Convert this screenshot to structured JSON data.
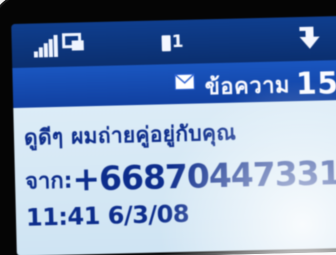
{
  "status_bar": {
    "signal_label": "",
    "sim_slot": "1",
    "colors": {
      "bar": "#0b2f6f",
      "icons": "#f4f7ff"
    },
    "icons": [
      "signal-strength-icon",
      "network-icon",
      "sim-card-icon",
      "arrow-icon"
    ]
  },
  "header": {
    "envelope_icon": "envelope-icon",
    "title": "ข้อความ",
    "message_index": "15",
    "colors": {
      "bar": "#1140a0",
      "text": "#fbfbff"
    }
  },
  "message": {
    "body": "ดูดีๆ ผมถ่ายคู่อยู่กับคุณ",
    "from_label": "จาก:",
    "from_number": "+66870447331",
    "time": "11:41",
    "date": "6/3/08",
    "colors": {
      "background": "#d6e8f5",
      "text": "#0d2d8c"
    }
  }
}
